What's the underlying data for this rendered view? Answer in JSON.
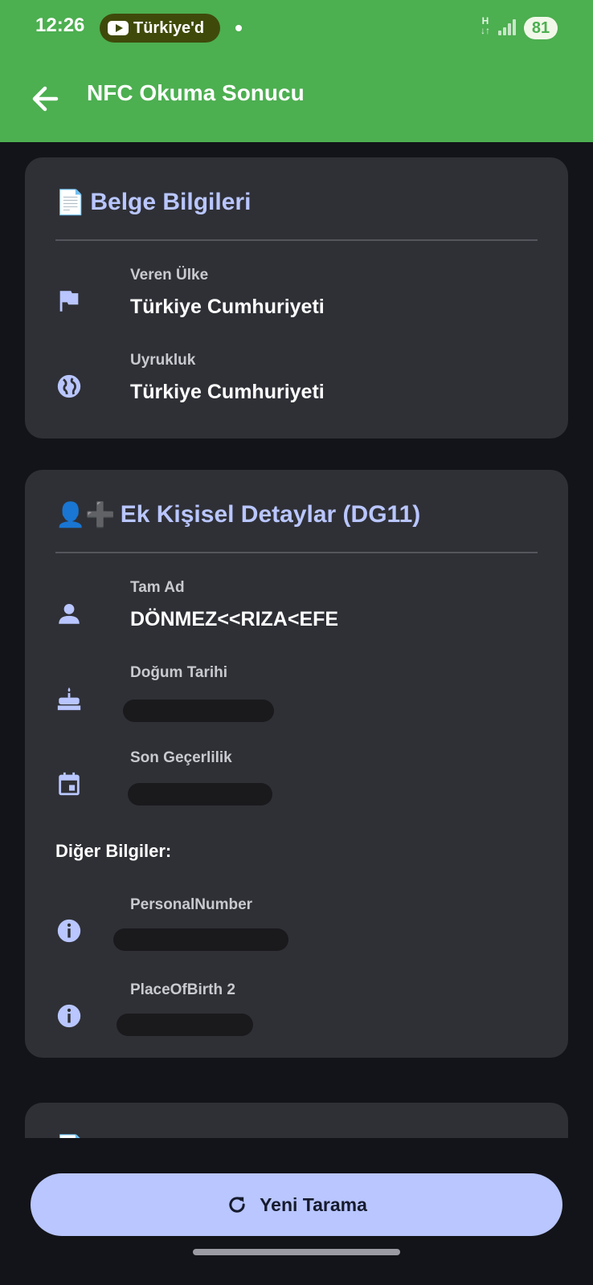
{
  "status_bar": {
    "time": "12:26",
    "notification_app": "Türkiye'd",
    "network_type": "H",
    "battery": "81"
  },
  "app_bar": {
    "title": "NFC Okuma Sonucu",
    "back_icon": "arrow-back-icon"
  },
  "document_card": {
    "emoji": "📄",
    "title": "Belge Bilgileri",
    "rows": [
      {
        "icon": "flag-icon",
        "label": "Veren Ülke",
        "value": "Türkiye Cumhuriyeti"
      },
      {
        "icon": "globe-icon",
        "label": "Uyrukluk",
        "value": "Türkiye Cumhuriyeti"
      }
    ]
  },
  "personal_card": {
    "emoji": "👤➕",
    "title": "Ek Kişisel Detaylar (DG11)",
    "rows": [
      {
        "icon": "person-icon",
        "label": "Tam Ad",
        "value": "DÖNMEZ<<RIZA<EFE"
      },
      {
        "icon": "cake-icon",
        "label": "Doğum Tarihi",
        "value": ""
      },
      {
        "icon": "calendar-icon",
        "label": "Son Geçerlilik",
        "value": ""
      }
    ],
    "other_label": "Diğer Bilgiler:",
    "other_rows": [
      {
        "icon": "info-icon",
        "label": "PersonalNumber",
        "value": ""
      },
      {
        "icon": "info-icon",
        "label": "PlaceOfBirth 2",
        "value": ""
      }
    ]
  },
  "third_card": {
    "emoji": "📄"
  },
  "bottom_button": {
    "icon": "refresh-icon",
    "label": "Yeni Tarama"
  },
  "colors": {
    "app_bar": "#4CAF50",
    "background": "#131419",
    "card": "#2f3036",
    "accent": "#b9c6ff"
  }
}
